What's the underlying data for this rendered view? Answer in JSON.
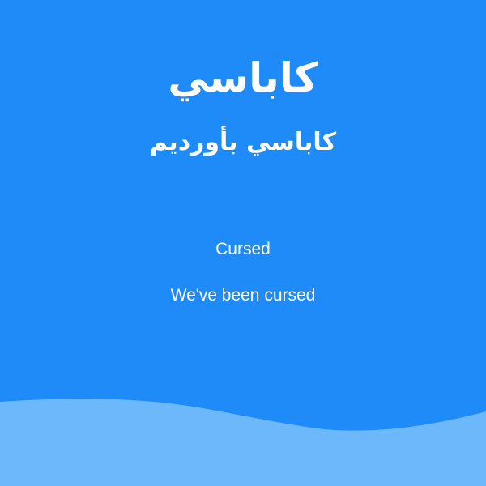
{
  "page": {
    "title": "كاباسي",
    "subtitle": "كاباسي بأورديم",
    "heading": "Cursed",
    "message": "We've been cursed"
  },
  "colors": {
    "background": "#1e8bf8",
    "wave": "#6cb8fb",
    "text": "#ffffff"
  }
}
